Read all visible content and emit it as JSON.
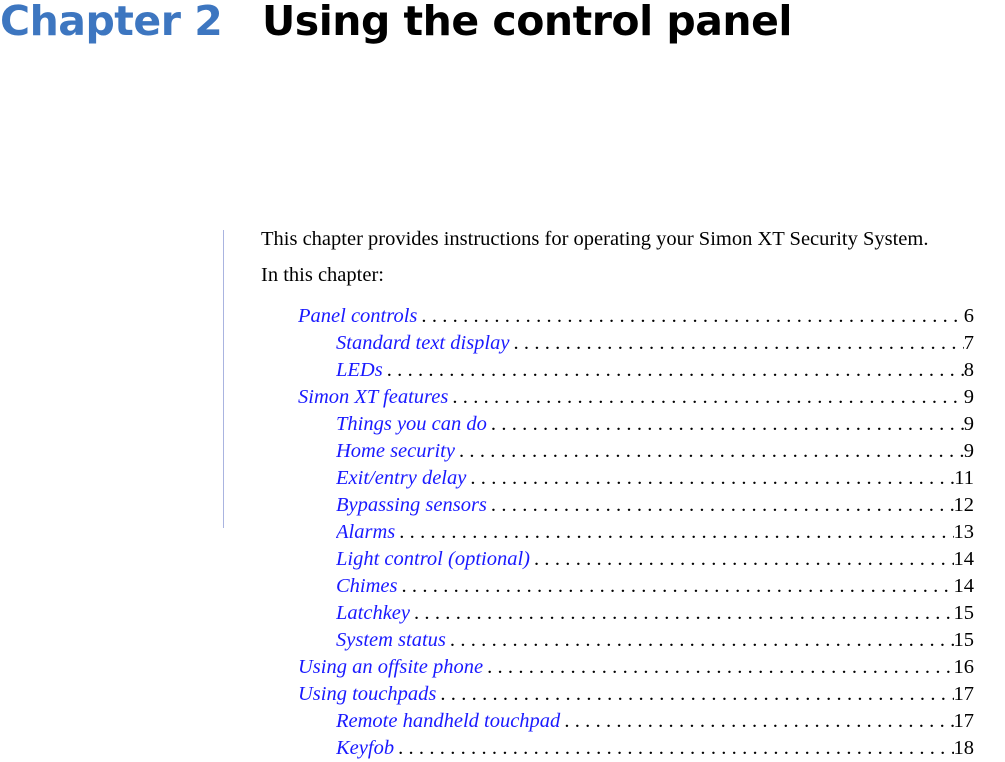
{
  "chapter": {
    "label": "Chapter 2",
    "title": "Using the control panel",
    "label_color": "#3d76c0"
  },
  "intro": "This chapter provides instructions for operating your Simon XT Security System.",
  "in_this_chapter": "In this chapter:",
  "link_color": "#1a1aff",
  "toc": [
    {
      "level": 1,
      "title": "Panel controls",
      "page": "6"
    },
    {
      "level": 2,
      "title": "Standard text display",
      "page": "7"
    },
    {
      "level": 2,
      "title": "LEDs",
      "page": "8"
    },
    {
      "level": 1,
      "title": "Simon XT features",
      "page": "9"
    },
    {
      "level": 2,
      "title": "Things you can do",
      "page": "9"
    },
    {
      "level": 2,
      "title": "Home security",
      "page": "9"
    },
    {
      "level": 2,
      "title": "Exit/entry delay",
      "page": "11"
    },
    {
      "level": 2,
      "title": "Bypassing sensors",
      "page": "12"
    },
    {
      "level": 2,
      "title": "Alarms",
      "page": "13"
    },
    {
      "level": 2,
      "title": "Light control (optional)",
      "page": "14"
    },
    {
      "level": 2,
      "title": "Chimes",
      "page": "14"
    },
    {
      "level": 2,
      "title": "Latchkey",
      "page": "15"
    },
    {
      "level": 2,
      "title": "System status",
      "page": "15"
    },
    {
      "level": 1,
      "title": "Using an offsite phone",
      "page": "16"
    },
    {
      "level": 1,
      "title": "Using touchpads",
      "page": "17"
    },
    {
      "level": 2,
      "title": "Remote handheld touchpad",
      "page": "17"
    },
    {
      "level": 2,
      "title": "Keyfob",
      "page": "18"
    }
  ]
}
